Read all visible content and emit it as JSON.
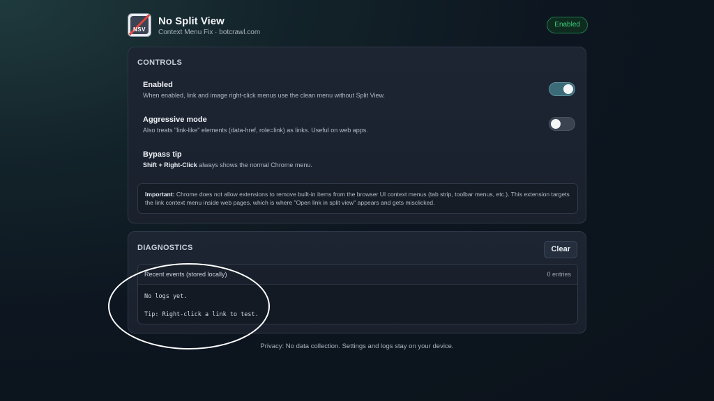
{
  "header": {
    "logo_text": "NSV",
    "title": "No Split View",
    "subtitle": "Context Menu Fix · botcrawl.com",
    "status_badge": "Enabled"
  },
  "controls": {
    "section_title": "CONTROLS",
    "enabled": {
      "title": "Enabled",
      "description": "When enabled, link and image right-click menus use the clean menu without Split View.",
      "state": "on"
    },
    "aggressive": {
      "title": "Aggressive mode",
      "description": "Also treats \"link-like\" elements (data-href, role=link) as links. Useful on web apps.",
      "state": "off"
    },
    "bypass": {
      "title": "Bypass tip",
      "keys": "Shift + Right-Click",
      "description_rest": " always shows the normal Chrome menu."
    },
    "notice": {
      "label": "Important:",
      "text": " Chrome does not allow extensions to remove built-in items from the browser UI context menus (tab strip, toolbar menus, etc.). This extension targets the link context menu inside web pages, which is where \"Open link in split view\" appears and gets misclicked."
    }
  },
  "diagnostics": {
    "section_title": "DIAGNOSTICS",
    "clear_label": "Clear",
    "log_header": "Recent events (stored locally)",
    "entries_count": "0 entries",
    "log_line1": "No logs yet.",
    "log_line2": "Tip: Right-click a link to test."
  },
  "footer": {
    "privacy": "Privacy: No data collection. Settings and logs stay on your device."
  },
  "colors": {
    "accent_green": "#3fcf7a",
    "toggle_on": "#3c6b78",
    "toggle_off": "#3b4350"
  }
}
